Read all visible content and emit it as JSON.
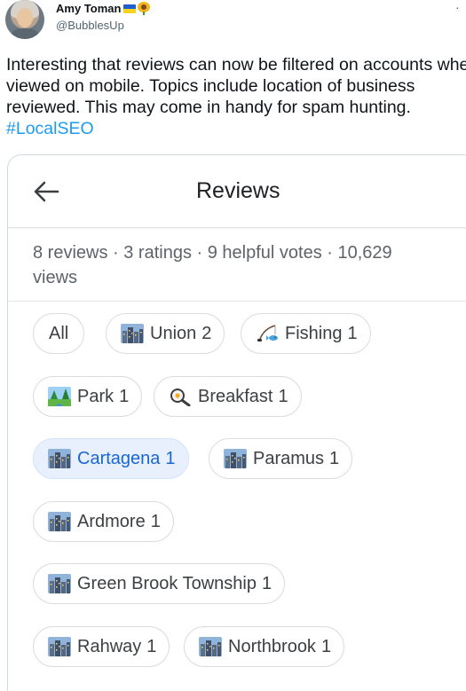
{
  "tweet": {
    "display_name": "Amy Toman",
    "handle": "@BubblesUp",
    "more_label": "·",
    "text": "Interesting that reviews can now be filtered on accounts when viewed on mobile. Topics include location of business reviewed. This may come in handy for spam hunting.",
    "hashtag": "#LocalSEO"
  },
  "screen": {
    "title": "Reviews",
    "summary": "8 reviews · 3 ratings · 9 helpful votes · 10,629 views",
    "chips": [
      {
        "label": "All",
        "count": "",
        "icon": "none",
        "selected": false
      },
      {
        "label": "Union",
        "count": "2",
        "icon": "city-icon",
        "selected": false
      },
      {
        "label": "Fishing",
        "count": "1",
        "icon": "fishing-icon",
        "selected": false
      },
      {
        "label": "Park",
        "count": "1",
        "icon": "park-icon",
        "selected": false
      },
      {
        "label": "Breakfast",
        "count": "1",
        "icon": "frying-pan-icon",
        "selected": false
      },
      {
        "label": "Cartagena",
        "count": "1",
        "icon": "city-icon",
        "selected": true
      },
      {
        "label": "Paramus",
        "count": "1",
        "icon": "city-icon",
        "selected": false
      },
      {
        "label": "Ardmore",
        "count": "1",
        "icon": "city-icon",
        "selected": false
      },
      {
        "label": "Green Brook Township",
        "count": "1",
        "icon": "city-icon",
        "selected": false
      },
      {
        "label": "Rahway",
        "count": "1",
        "icon": "city-icon",
        "selected": false
      },
      {
        "label": "Northbrook",
        "count": "1",
        "icon": "city-icon",
        "selected": false
      }
    ]
  },
  "colors": {
    "hashtag": "#1d9bf0",
    "chip_selected_bg": "#e8f0fe",
    "chip_selected_text": "#1967d2"
  }
}
